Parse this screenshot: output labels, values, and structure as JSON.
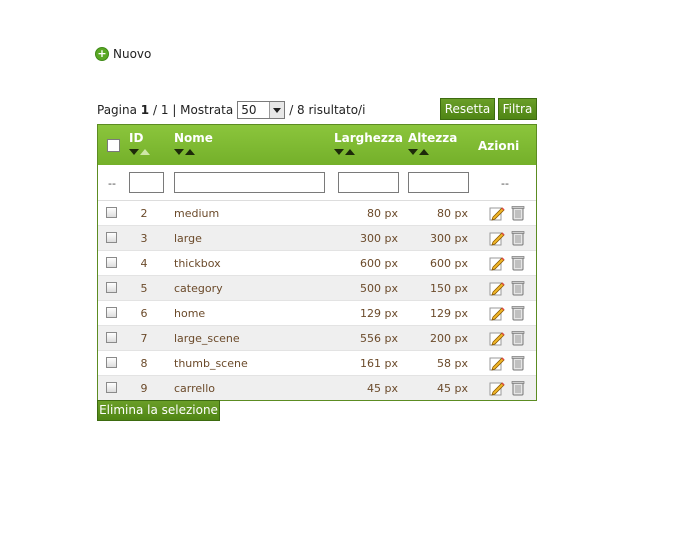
{
  "new_link": {
    "label": "Nuovo",
    "icon": "plus-circle-icon"
  },
  "pager": {
    "page_label": "Pagina",
    "current_page": "1",
    "sep": "/",
    "total_pages": "1",
    "show_label": "| Mostrata",
    "per_page": "50",
    "results": "/ 8 risultato/i"
  },
  "buttons": {
    "reset": "Resetta",
    "filter": "Filtra",
    "delete_selected": "Elimina la selezione"
  },
  "columns": {
    "id": "ID",
    "name": "Nome",
    "width": "Larghezza",
    "height": "Altezza",
    "actions": "Azioni"
  },
  "filter_row": {
    "dash_left": "--",
    "dash_right": "--"
  },
  "rows": [
    {
      "id": "2",
      "name": "medium",
      "width": "80 px",
      "height": "80 px"
    },
    {
      "id": "3",
      "name": "large",
      "width": "300 px",
      "height": "300 px"
    },
    {
      "id": "4",
      "name": "thickbox",
      "width": "600 px",
      "height": "600 px"
    },
    {
      "id": "5",
      "name": "category",
      "width": "500 px",
      "height": "150 px"
    },
    {
      "id": "6",
      "name": "home",
      "width": "129 px",
      "height": "129 px"
    },
    {
      "id": "7",
      "name": "large_scene",
      "width": "556 px",
      "height": "200 px"
    },
    {
      "id": "8",
      "name": "thumb_scene",
      "width": "161 px",
      "height": "58 px"
    },
    {
      "id": "9",
      "name": "carrello",
      "width": "45 px",
      "height": "45 px"
    }
  ],
  "colors": {
    "header_green": "#7cb832",
    "button_green": "#5a8f1e",
    "row_alt": "#efefef",
    "cell_text": "#6b4a2a"
  }
}
